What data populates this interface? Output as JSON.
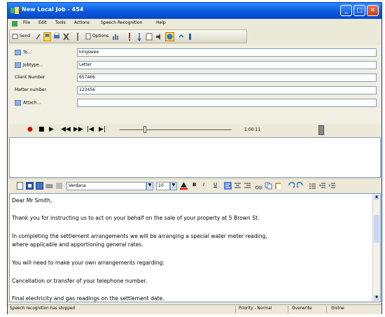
{
  "window": {
    "title": "New Local Job - 454"
  },
  "menu": [
    "File",
    "Edit",
    "Tools",
    "Actions",
    "Speech Recognition",
    "Help"
  ],
  "toolbar": {
    "send_label": "Send",
    "options_label": "Options"
  },
  "form": {
    "to_label": "To...",
    "to_value": "kingswee",
    "jobtype_label": "Jobtype...",
    "jobtype_value": "Letter",
    "client_label": "Client Number",
    "client_value": "657466",
    "matter_label": "Matter number",
    "matter_value": "123456",
    "attach_label": "Attach...",
    "attach_value": ""
  },
  "media": {
    "time": "1:00:11"
  },
  "format": {
    "font": "Verdana",
    "size": "10"
  },
  "letter": [
    "Dear Mr Smith,",
    "Thank you for instructing us to act on your behalf on the sale of your property at 5 Brown St.",
    "In completing the settlement arrangements we will be arranging a special water meter reading,",
    "where applicable and apportioning general rates.",
    "You will need to make your own arrangements regarding:",
    "Cancellation or transfer of your telephone number.",
    "Final electricity and gas readings on the settlement date."
  ],
  "status": {
    "message": "Speech recognition has stopped",
    "priority": "Priority - Normal",
    "mode": "Overwrite",
    "connection": "Online"
  }
}
